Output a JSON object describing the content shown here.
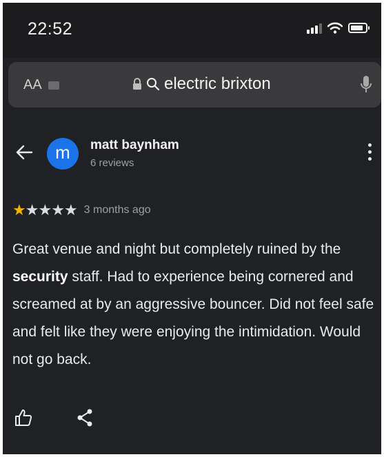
{
  "status_bar": {
    "time": "22:52",
    "icons": [
      "cellular-signal-icon",
      "wifi-icon",
      "battery-icon"
    ]
  },
  "browser": {
    "text_size_label": "AA",
    "url_text": "electric brixton",
    "icons": [
      "extension-icon",
      "lock-icon",
      "search-icon",
      "microphone-icon"
    ]
  },
  "review": {
    "author_initial": "m",
    "author_name": "matt baynham",
    "author_reviews": "6 reviews",
    "rating": 1,
    "rating_max": 5,
    "time_ago": "3 months ago",
    "body_before": "Great venue and night but completely ruined by the ",
    "body_highlight": "security",
    "body_after": " staff. Had to experience being cornered and screamed at by an aggressive bouncer. Did not feel safe and felt like they were enjoying the intimidation. Would not go back."
  },
  "colors": {
    "background": "#202124",
    "avatar": "#1a73e8",
    "star_filled": "#f5b400",
    "star_empty": "#dadce0",
    "secondary_text": "#9aa0a6"
  }
}
